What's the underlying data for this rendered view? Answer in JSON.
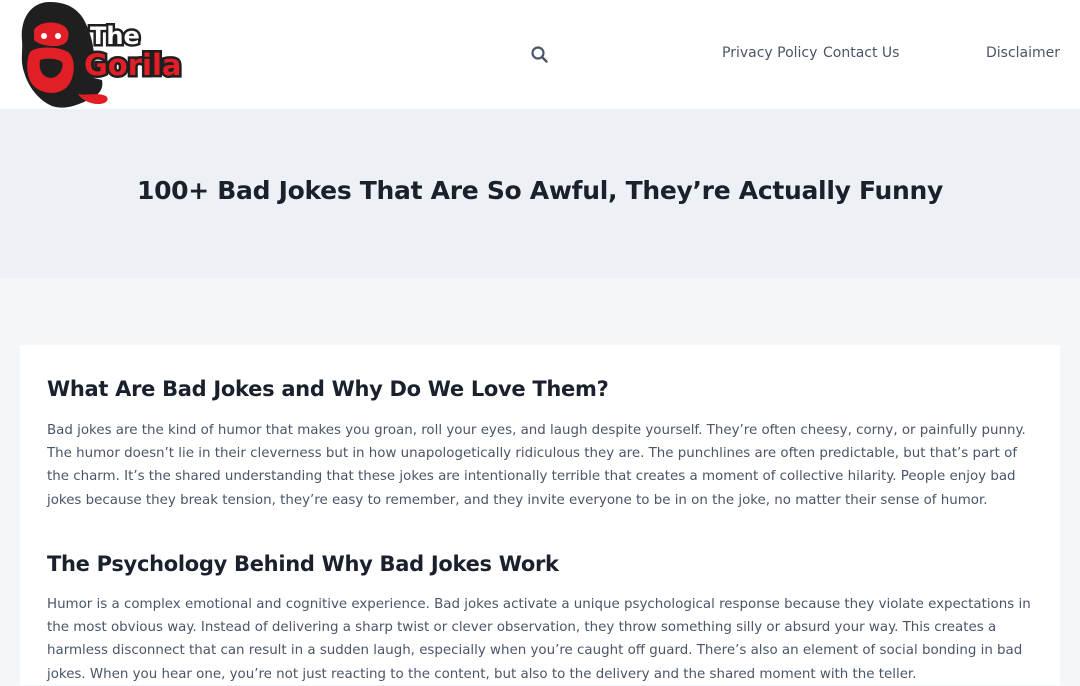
{
  "header": {
    "logo": {
      "line1": "The",
      "line2": "Gorila",
      "icon": "gorilla-head-icon"
    },
    "search_icon": "search-icon",
    "nav": [
      {
        "label": "Privacy Policy"
      },
      {
        "label": "Contact Us"
      },
      {
        "label": "Disclaimer"
      }
    ]
  },
  "hero": {
    "title": "100+ Bad Jokes That Are So Awful, They’re Actually Funny"
  },
  "article": {
    "sections": [
      {
        "heading": "What Are Bad Jokes and Why Do We Love Them?",
        "body": "Bad jokes are the kind of humor that makes you groan, roll your eyes, and laugh despite yourself. They’re often cheesy, corny, or painfully punny. The humor doesn’t lie in their cleverness but in how unapologetically ridiculous they are. The punchlines are often predictable, but that’s part of the charm. It’s the shared understanding that these jokes are intentionally terrible that creates a moment of collective hilarity. People enjoy bad jokes because they break tension, they’re easy to remember, and they invite everyone to be in on the joke, no matter their sense of humor."
      },
      {
        "heading": "The Psychology Behind Why Bad Jokes Work",
        "body": "Humor is a complex emotional and cognitive experience. Bad jokes activate a unique psychological response because they violate expectations in the most obvious way. Instead of delivering a sharp twist or clever observation, they throw something silly or absurd your way. This creates a harmless disconnect that can result in a sudden laugh, especially when you’re caught off guard. There’s also an element of social bonding in bad jokes. When you hear one, you’re not just reacting to the content, but also to the delivery and the shared moment with the teller."
      }
    ]
  },
  "colors": {
    "brand_red": "#e21f26",
    "logo_dark": "#1f1f1f",
    "header_bg": "#ffffff",
    "hero_bg": "#edf1f5",
    "page_bg": "#f4f7fa",
    "heading_text": "#1a202c",
    "body_text": "#4a5568"
  }
}
